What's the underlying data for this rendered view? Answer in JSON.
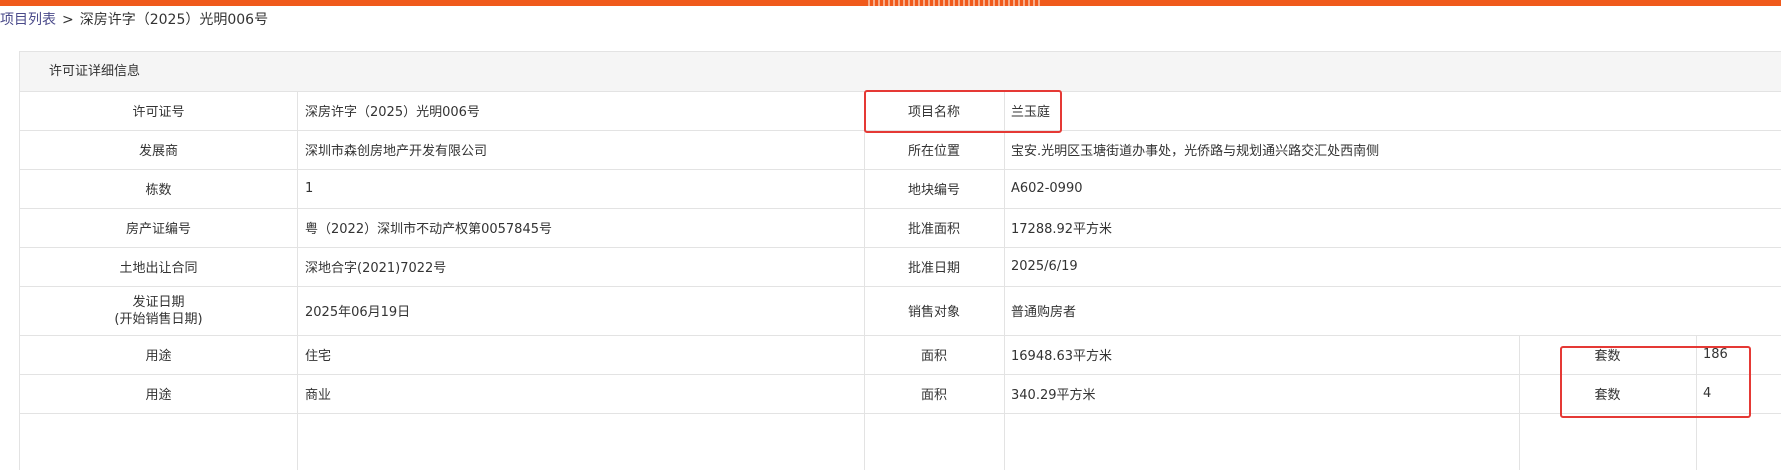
{
  "breadcrumb": {
    "root": "项目列表",
    "separator": ">",
    "current": "深房许字（2025）光明006号"
  },
  "panel": {
    "title": "许可证详细信息"
  },
  "rows": [
    {
      "left_label": "许可证号",
      "left_value": "深房许字（2025）光明006号",
      "right_label": "项目名称",
      "right_value": "兰玉庭"
    },
    {
      "left_label": "发展商",
      "left_value": "深圳市森创房地产开发有限公司",
      "right_label": "所在位置",
      "right_value": "宝安.光明区玉塘街道办事处，光侨路与规划通兴路交汇处西南侧"
    },
    {
      "left_label": "栋数",
      "left_value": "1",
      "right_label": "地块编号",
      "right_value": "A602-0990"
    },
    {
      "left_label": "房产证编号",
      "left_value": "粤（2022）深圳市不动产权第0057845号",
      "right_label": "批准面积",
      "right_value": "17288.92平方米"
    },
    {
      "left_label": "土地出让合同",
      "left_value": "深地合字(2021)7022号",
      "right_label": "批准日期",
      "right_value": "2025/6/19"
    },
    {
      "left_label_line1": "发证日期",
      "left_label_line2": "(开始销售日期)",
      "left_value": "2025年06月19日",
      "right_label": "销售对象",
      "right_value": "普通购房者"
    }
  ],
  "usage_rows": [
    {
      "usage_label": "用途",
      "usage_value": "住宅",
      "area_label": "面积",
      "area_value": "16948.63平方米",
      "units_label": "套数",
      "units_value": "186"
    },
    {
      "usage_label": "用途",
      "usage_value": "商业",
      "area_label": "面积",
      "area_value": "340.29平方米",
      "units_label": "套数",
      "units_value": "4"
    }
  ],
  "colors": {
    "accent": "#f05a1c",
    "highlight": "#e53935",
    "header_bg": "#f5f5f5",
    "border": "#e3e3e3"
  }
}
